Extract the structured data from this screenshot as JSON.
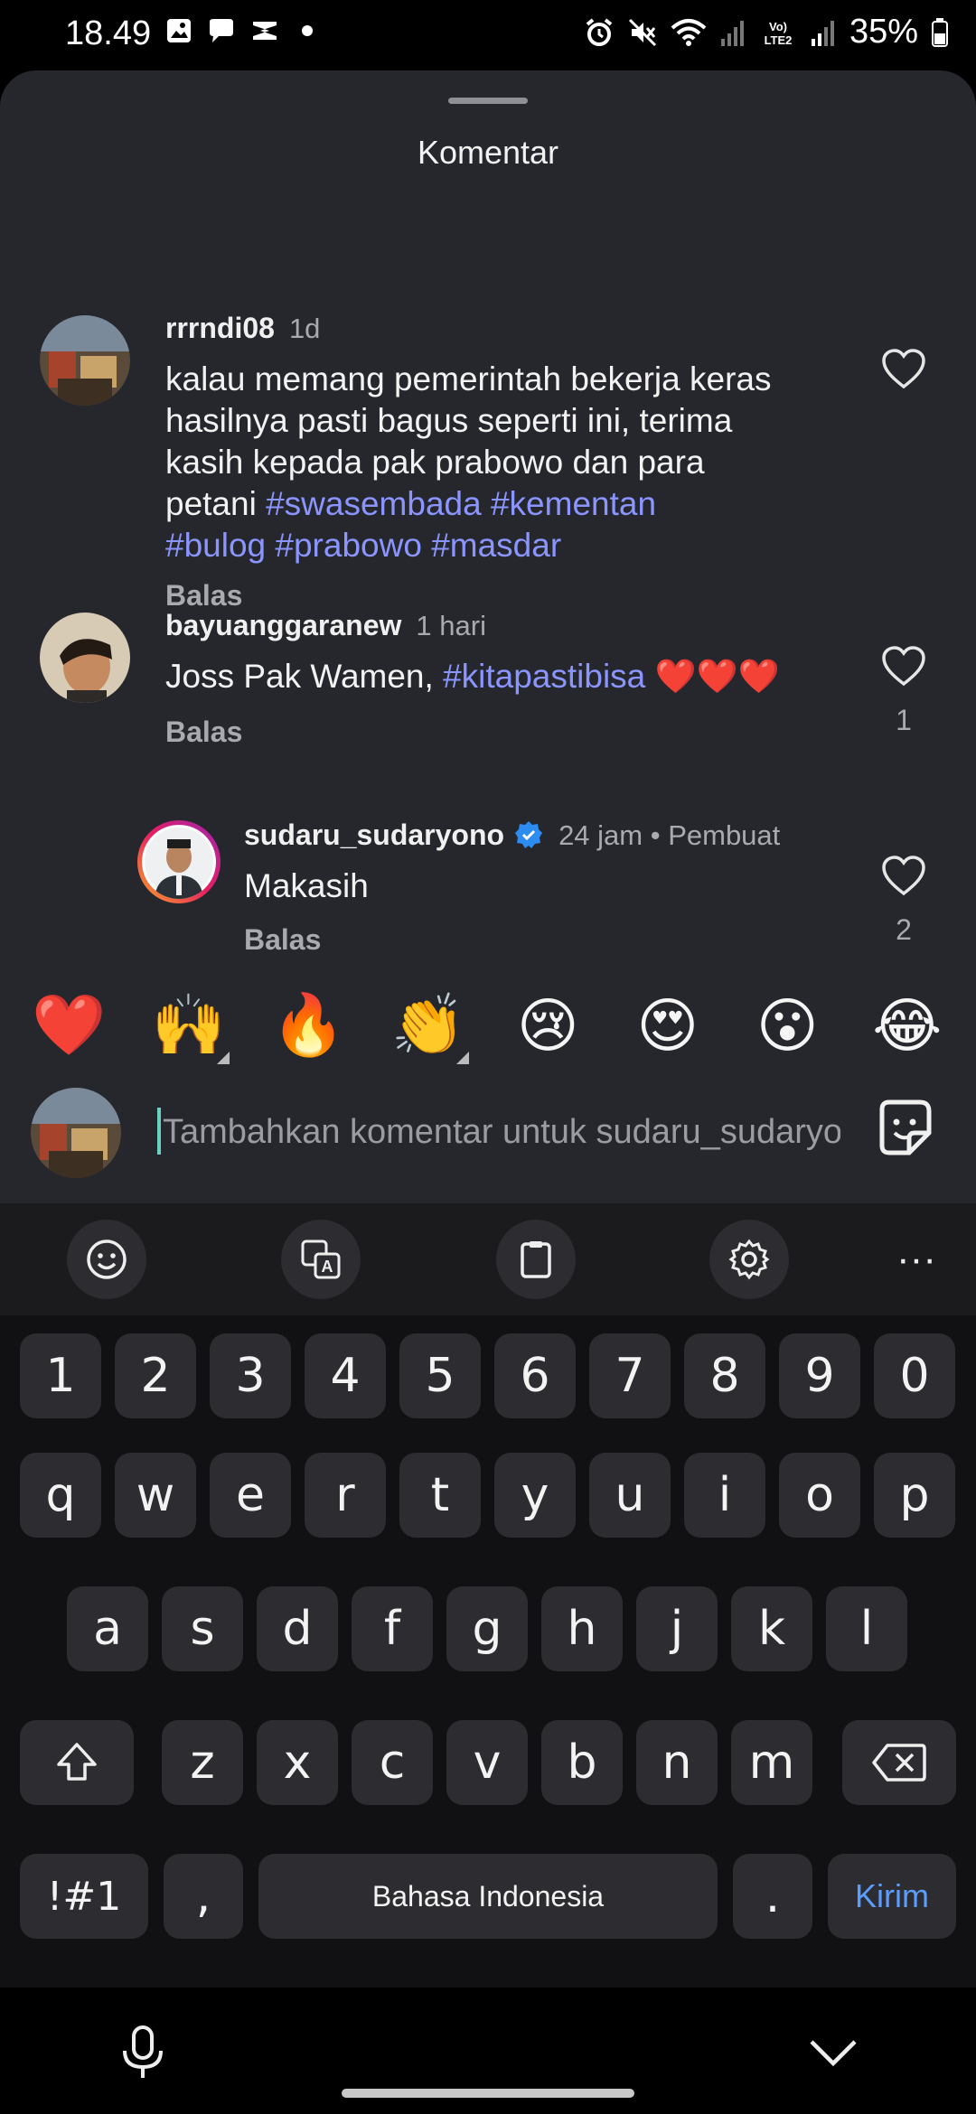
{
  "status_bar": {
    "time": "18.49",
    "battery": "35%",
    "network_label": "Vo) LTE2"
  },
  "sheet": {
    "title": "Komentar"
  },
  "comments": [
    {
      "username": "rrrndi08",
      "time": "1d",
      "text_plain": "kalau memang pemerintah bekerja keras hasilnya pasti bagus seperti ini, terima kasih kepada pak prabowo dan para petani ",
      "text_line1": "kalau memang pemerintah bekerja keras",
      "text_line2": "hasilnya pasti bagus seperti ini, terima",
      "text_line3": "kasih kepada pak prabowo dan para",
      "text_line4_plain": "petani ",
      "hashtags": [
        "#swasembada",
        "#kementan",
        "#bulog",
        "#prabowo",
        "#masdar"
      ],
      "reply_label": "Balas"
    },
    {
      "username": "bayuanggaranew",
      "time": "1 hari",
      "text_plain": "Joss Pak Wamen, ",
      "hashtag": "#kitapastibisa",
      "emoji": "❤️❤️❤️",
      "reply_label": "Balas",
      "like_count": "1"
    },
    {
      "username": "sudaru_sudaryono",
      "time": "24 jam",
      "creator_label": "Pembuat",
      "text": "Makasih",
      "reply_label": "Balas",
      "like_count": "2"
    }
  ],
  "emoji_reactions": [
    "❤️",
    "🙌",
    "🔥",
    "👏",
    "😢",
    "😍",
    "😮",
    "😂"
  ],
  "input": {
    "placeholder": "Tambahkan komentar untuk sudaru_sudaryono..."
  },
  "keyboard": {
    "row_numbers": [
      "1",
      "2",
      "3",
      "4",
      "5",
      "6",
      "7",
      "8",
      "9",
      "0"
    ],
    "row_top": [
      "q",
      "w",
      "e",
      "r",
      "t",
      "y",
      "u",
      "i",
      "o",
      "p"
    ],
    "row_mid": [
      "a",
      "s",
      "d",
      "f",
      "g",
      "h",
      "j",
      "k",
      "l"
    ],
    "row_bottom": [
      "z",
      "x",
      "c",
      "v",
      "b",
      "n",
      "m"
    ],
    "symbols_key": "!#1",
    "comma_key": ",",
    "space_label": "Bahasa Indonesia",
    "period_key": ".",
    "send_label": "Kirim",
    "more_label": "···"
  }
}
